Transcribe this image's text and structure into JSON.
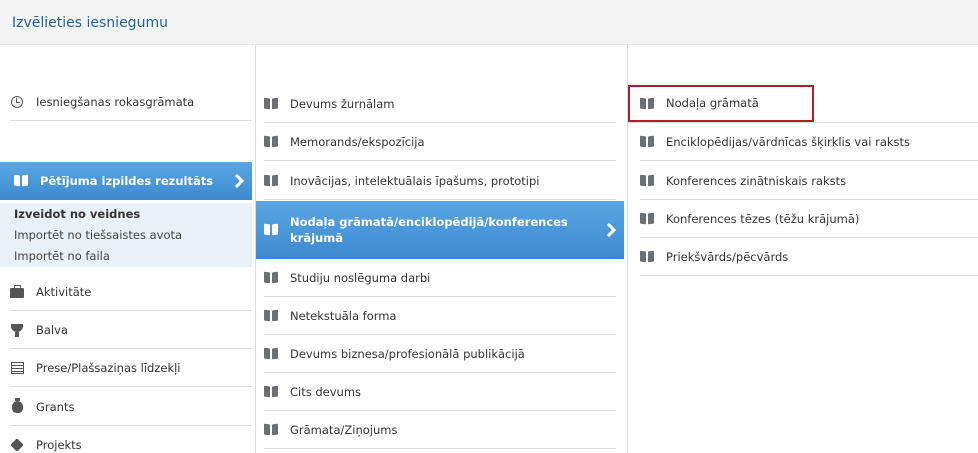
{
  "header": {
    "title": "Izvēlieties iesniegumu"
  },
  "col1": {
    "items": [
      {
        "label": "Iesniegšanas rokasgrāmata",
        "icon": "history-icon"
      },
      {
        "label": "Pētījuma izpildes rezultāts",
        "icon": "book-icon",
        "active": true
      },
      {
        "label": "Aktivitāte",
        "icon": "briefcase-icon"
      },
      {
        "label": "Balva",
        "icon": "trophy-icon"
      },
      {
        "label": "Prese/Plašsaziņas līdzekļi",
        "icon": "press-icon"
      },
      {
        "label": "Grants",
        "icon": "money-bag-icon"
      },
      {
        "label": "Projekts",
        "icon": "cube-icon"
      }
    ],
    "submenu": [
      "Izveidot no veidnes",
      "Importēt no tiešsaistes avota",
      "Importēt no faila"
    ]
  },
  "col2": {
    "items": [
      "Devums žurnālam",
      "Memorands/ekspozīcija",
      "Inovācijas, intelektuālais īpašums, prototipi",
      "Nodaļa grāmatā/enciklopēdijā/konferences krājumā",
      "Studiju noslēguma darbi",
      "Netekstuāla forma",
      "Devums biznesa/profesionālā publikācijā",
      "Cits devums",
      "Grāmata/Ziņojums"
    ]
  },
  "col3": {
    "items": [
      "Nodaļa grāmatā",
      "Enciklopēdijas/vārdnīcas šķirklis vai raksts",
      "Konferences zinātniskais raksts",
      "Konferences tēzes (tēžu krājumā)",
      "Priekšvārds/pēcvārds"
    ]
  },
  "colors": {
    "accent": "#3d8ad0",
    "highlight_border": "#b01e2a",
    "title": "#1f5f9a"
  }
}
